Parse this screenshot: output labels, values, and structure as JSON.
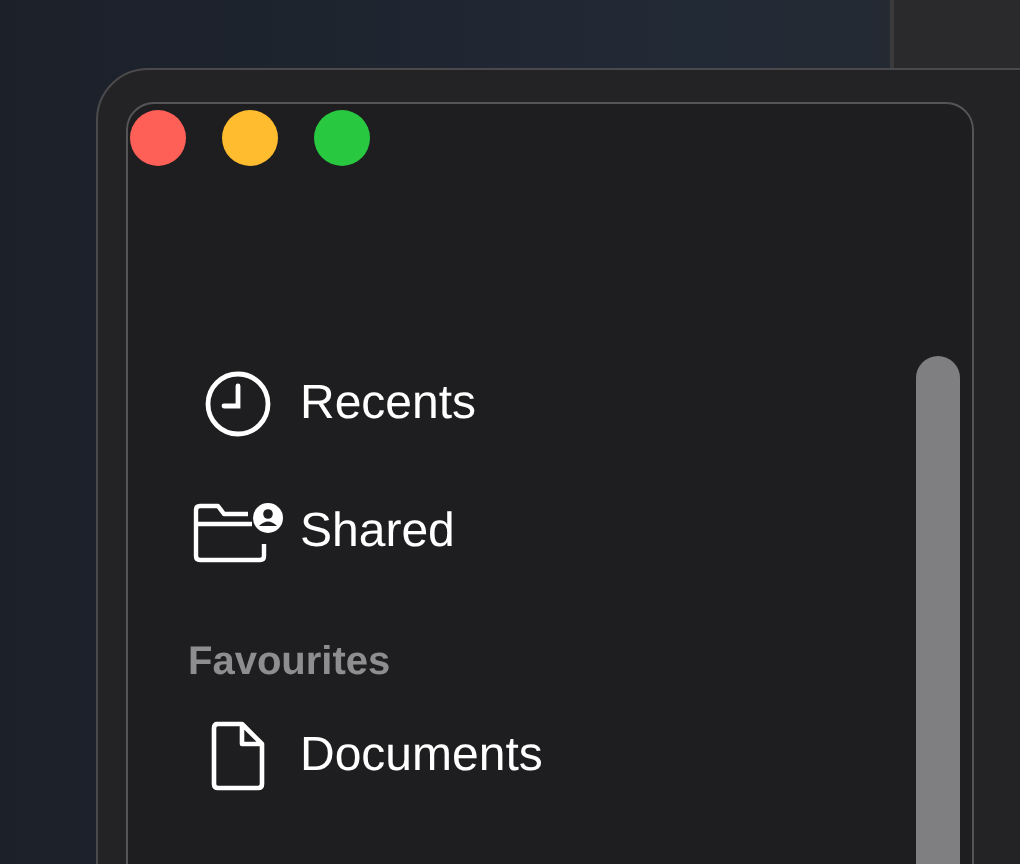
{
  "sidebar": {
    "items": [
      {
        "label": "Recents",
        "kind": "clock"
      },
      {
        "label": "Shared",
        "kind": "shared-folder"
      }
    ],
    "sections": [
      {
        "title": "Favourites",
        "items": [
          {
            "label": "Documents",
            "kind": "document"
          }
        ]
      }
    ]
  }
}
